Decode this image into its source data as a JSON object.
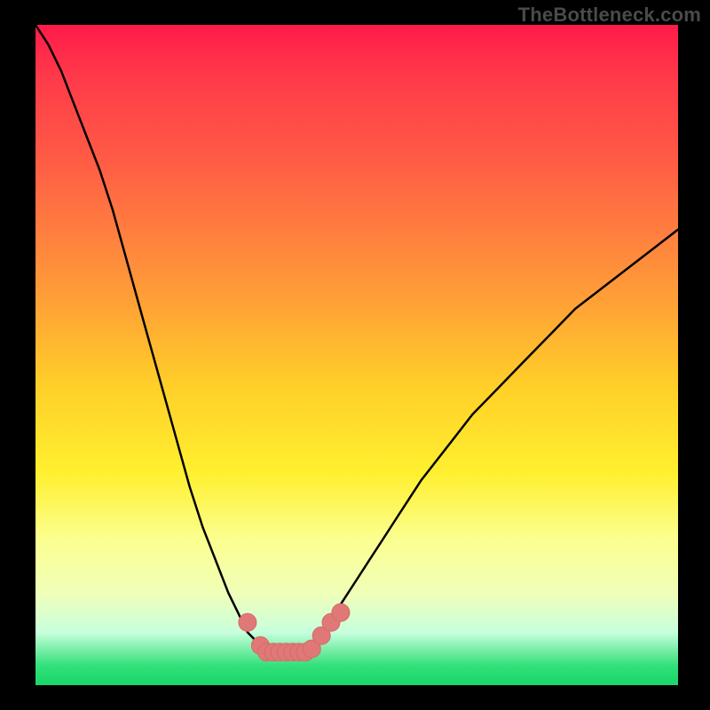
{
  "watermark": "TheBottleneck.com",
  "colors": {
    "curve_stroke": "#000000",
    "marker_fill": "#e07878",
    "marker_stroke": "#d86a6a"
  },
  "chart_data": {
    "type": "line",
    "title": "",
    "xlabel": "",
    "ylabel": "",
    "xlim": [
      0,
      100
    ],
    "ylim": [
      0,
      100
    ],
    "note": "V-shaped bottleneck curve; y = |value| as percent, minimum near x≈38.",
    "x": [
      0,
      2,
      4,
      6,
      8,
      10,
      12,
      14,
      16,
      18,
      20,
      22,
      24,
      26,
      28,
      30,
      32,
      33,
      34,
      35,
      36,
      37,
      38,
      39,
      40,
      41,
      42,
      43,
      44,
      45,
      46,
      48,
      50,
      52,
      54,
      56,
      58,
      60,
      64,
      68,
      72,
      76,
      80,
      84,
      88,
      92,
      96,
      100
    ],
    "values": [
      100,
      97,
      93,
      88,
      83,
      78,
      72,
      65,
      58,
      51,
      44,
      37,
      30,
      24,
      19,
      14,
      10,
      8,
      7,
      6,
      5,
      5,
      5,
      5,
      5,
      5,
      5,
      6,
      7,
      8,
      10,
      13,
      16,
      19,
      22,
      25,
      28,
      31,
      36,
      41,
      45,
      49,
      53,
      57,
      60,
      63,
      66,
      69
    ],
    "marker_points": [
      {
        "x": 33,
        "y": 9.5
      },
      {
        "x": 35,
        "y": 6.0
      },
      {
        "x": 36,
        "y": 5.0
      },
      {
        "x": 37,
        "y": 5.0
      },
      {
        "x": 38,
        "y": 5.0
      },
      {
        "x": 39,
        "y": 5.0
      },
      {
        "x": 40,
        "y": 5.0
      },
      {
        "x": 41,
        "y": 5.0
      },
      {
        "x": 42,
        "y": 5.0
      },
      {
        "x": 43,
        "y": 5.5
      },
      {
        "x": 44.5,
        "y": 7.5
      },
      {
        "x": 46,
        "y": 9.5
      },
      {
        "x": 47.5,
        "y": 11
      }
    ]
  }
}
